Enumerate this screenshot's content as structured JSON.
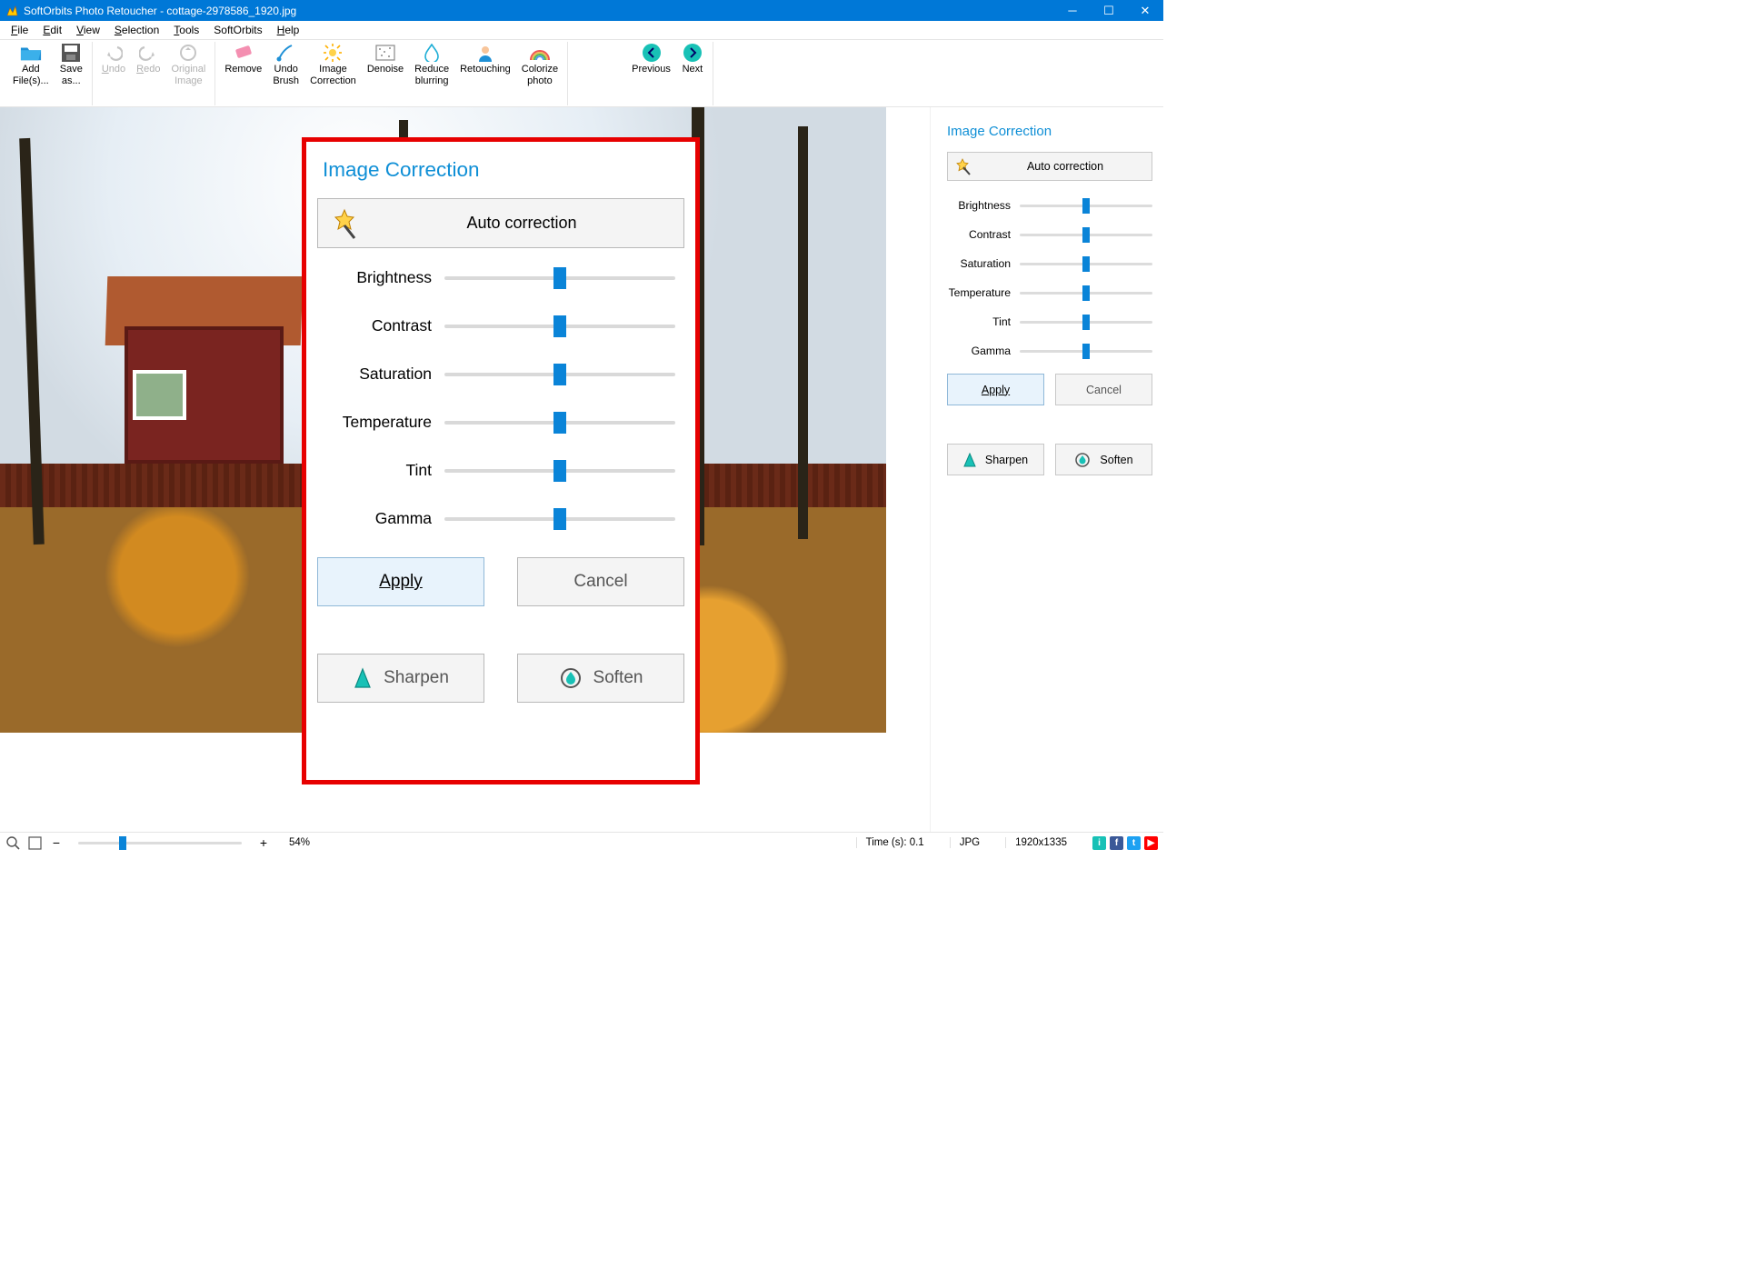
{
  "titlebar": {
    "app_name": "SoftOrbits Photo Retoucher",
    "file_name": "cottage-2978586_1920.jpg"
  },
  "menu": [
    "File",
    "Edit",
    "View",
    "Selection",
    "Tools",
    "SoftOrbits",
    "Help"
  ],
  "toolbar": {
    "add_files": "Add\nFile(s)...",
    "save_as": "Save\nas...",
    "undo": "Undo",
    "redo": "Redo",
    "original_image": "Original\nImage",
    "remove": "Remove",
    "undo_brush": "Undo\nBrush",
    "image_correction": "Image\nCorrection",
    "denoise": "Denoise",
    "reduce_blurring": "Reduce\nblurring",
    "retouching": "Retouching",
    "colorize_photo": "Colorize\nphoto",
    "previous": "Previous",
    "next": "Next"
  },
  "panel": {
    "title": "Image Correction",
    "auto_correction": "Auto correction",
    "sliders": [
      "Brightness",
      "Contrast",
      "Saturation",
      "Temperature",
      "Tint",
      "Gamma"
    ],
    "apply": "Apply",
    "cancel": "Cancel",
    "sharpen": "Sharpen",
    "soften": "Soften"
  },
  "statusbar": {
    "zoom_percent": "54%",
    "time_label": "Time (s): 0.1",
    "format": "JPG",
    "dimensions": "1920x1335"
  }
}
